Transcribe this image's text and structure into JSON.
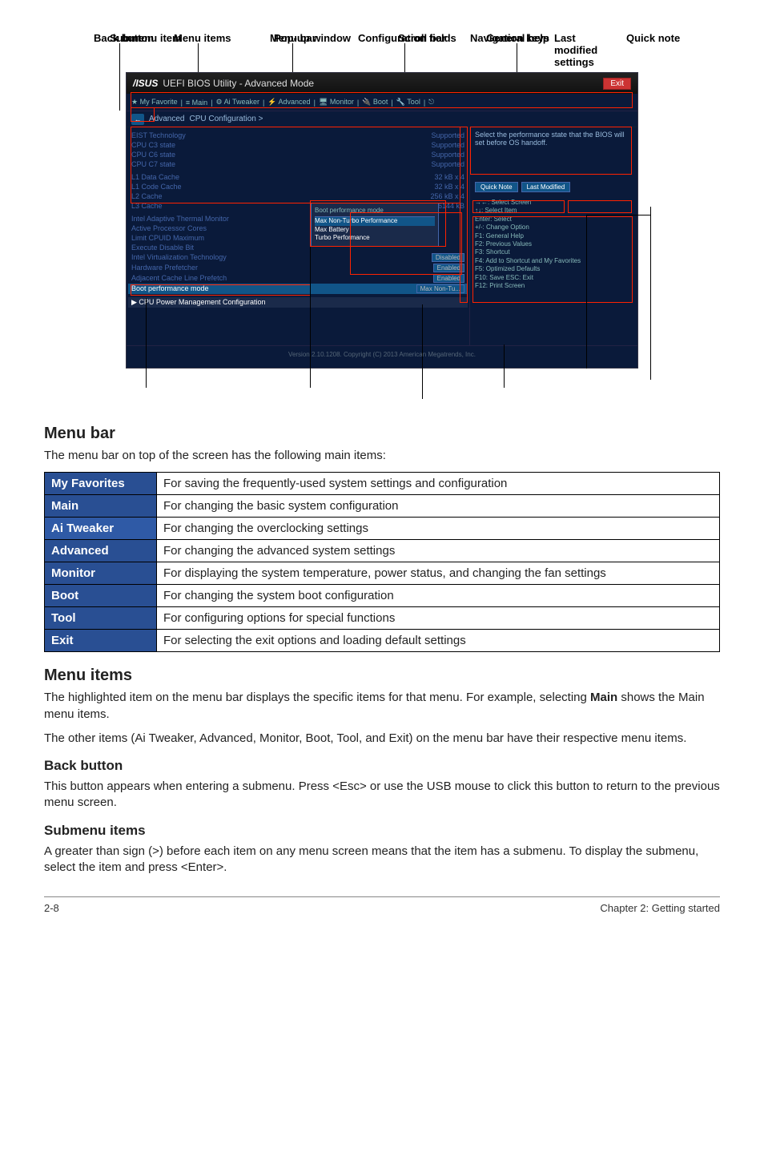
{
  "diagram": {
    "top_labels": {
      "back_button": "Back button",
      "menu_items": "Menu items",
      "menu_bar": "Menu bar",
      "config_fields": "Configuration fields",
      "general_help": "General help"
    },
    "bottom_labels": {
      "submenu_item": "Submenu item",
      "popup_window": "Pop-up window",
      "scroll_bar": "Scroll bar",
      "nav_keys": "Navigation keys",
      "last_modified": "Last modified settings",
      "quick_note": "Quick note"
    },
    "bios": {
      "title": "UEFI BIOS Utility - Advanced Mode",
      "logo": "/ISUS",
      "exit": "Exit",
      "tabs": [
        "★ My Favorite",
        "≡ Main",
        "⚙ Ai Tweaker",
        "⚡ Advanced",
        "🖥 Monitor",
        "🔌 Boot",
        "🔧 Tool",
        "⎋"
      ],
      "crumb_label": "Advanced",
      "crumb_path": "CPU Configuration >",
      "left_block1": [
        "EIST Technology",
        "CPU C3 state",
        "CPU C6 state",
        "CPU C7 state"
      ],
      "left_block2": [
        "L1 Data Cache",
        "L1 Code Cache",
        "L2 Cache",
        "L3 Cache"
      ],
      "left_block3": [
        "Intel Adaptive Thermal Monitor",
        "Active Processor Cores",
        "Limit CPUID Maximum",
        "Execute Disable Bit",
        "Intel Virtualization Technology",
        "Hardware Prefetcher",
        "Adjacent Cache Line Prefetch"
      ],
      "left_block3_vals": [
        "",
        "",
        "",
        "",
        "Disabled",
        "Enabled",
        "Enabled"
      ],
      "sel_row_left": "Boot performance mode",
      "sel_row_right": "Max Non-Tu...",
      "submenu_row": "▶ CPU Power Management Configuration",
      "popup": {
        "title": "Boot performance mode",
        "items": [
          "Max Non-Turbo Performance",
          "Max Battery",
          "Turbo Performance"
        ]
      },
      "right": {
        "help": "Select the performance state that the BIOS will set before OS handoff.",
        "qn_btn1": "Quick Note",
        "qn_btn2": "Last Modified",
        "keys": [
          "→←: Select Screen",
          "↑↓: Select Item",
          "Enter: Select",
          "+/-: Change Option",
          "F1: General Help",
          "F2: Previous Values",
          "F3: Shortcut",
          "F4: Add to Shortcut and My Favorites",
          "F5: Optimized Defaults",
          "F10: Save  ESC: Exit",
          "F12: Print Screen"
        ]
      },
      "footer": "Version 2.10.1208. Copyright (C) 2013 American Megatrends, Inc."
    }
  },
  "sections": {
    "menu_bar": {
      "heading": "Menu bar",
      "intro": "The menu bar on top of the screen has the following main items:"
    },
    "menu_items": {
      "heading": "Menu items",
      "p1a": "The highlighted item on the menu bar displays the specific items for that menu. For example, selecting ",
      "p1b": "Main",
      "p1c": " shows the Main menu items.",
      "p2": "The other items (Ai Tweaker, Advanced, Monitor, Boot, Tool, and Exit) on the menu bar have their respective menu items."
    },
    "back_button": {
      "heading": "Back button",
      "p": "This button appears when entering a submenu. Press <Esc> or use the USB mouse to click this button to return to the previous menu screen."
    },
    "submenu_items": {
      "heading": "Submenu items",
      "p": "A greater than sign (>) before each item on any menu screen means that the item has a submenu. To display the submenu, select the item and press <Enter>."
    }
  },
  "menu_table": [
    {
      "name": "My Favorites",
      "desc": "For saving the frequently-used system settings and configuration"
    },
    {
      "name": "Main",
      "desc": "For changing the basic system configuration"
    },
    {
      "name": "Ai Tweaker",
      "desc": "For changing the overclocking settings"
    },
    {
      "name": "Advanced",
      "desc": "For changing the advanced system settings"
    },
    {
      "name": "Monitor",
      "desc": "For displaying the system temperature, power status, and changing the fan settings"
    },
    {
      "name": "Boot",
      "desc": "For changing the system boot configuration"
    },
    {
      "name": "Tool",
      "desc": "For configuring options for special functions"
    },
    {
      "name": "Exit",
      "desc": "For selecting the exit options and loading default settings"
    }
  ],
  "footer": {
    "left": "2-8",
    "right": "Chapter 2: Getting started"
  }
}
